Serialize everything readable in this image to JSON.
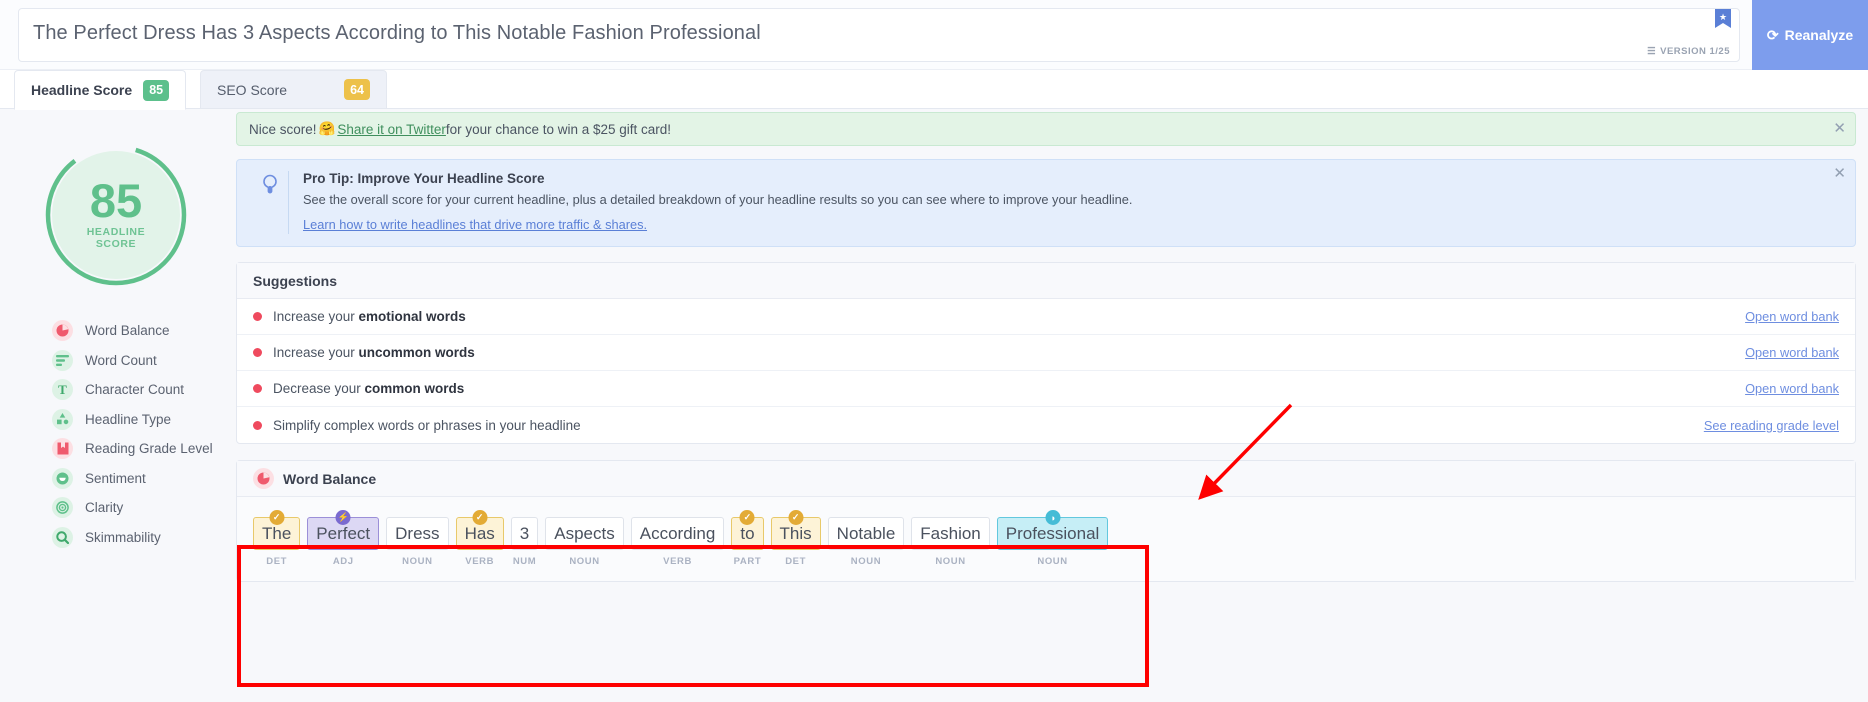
{
  "header": {
    "headline": "The Perfect Dress Has 3 Aspects According to This Notable Fashion Professional",
    "bookmark_icon": "bookmark-star-icon",
    "version_label": "VERSION 1/25",
    "version_icon": "layers-icon",
    "reanalyze_label": "Reanalyze",
    "reanalyze_icon": "refresh-icon",
    "reanalyze_color": "#7d9ded"
  },
  "tabs": [
    {
      "label": "Headline Score",
      "score": "85",
      "score_color": "#5cc08c",
      "active": true
    },
    {
      "label": "SEO Score",
      "score": "64",
      "score_color": "#edc14a",
      "active": false
    }
  ],
  "sidebar": {
    "gauge": {
      "value": "85",
      "label_line1": "HEADLINE",
      "label_line2": "SCORE",
      "color": "#5fc08b",
      "track_color": "#e2f3e9",
      "percent": 85
    },
    "items": [
      {
        "label": "Word Balance",
        "icon": "pie-chart-icon",
        "tone": "r"
      },
      {
        "label": "Word Count",
        "icon": "bars-icon",
        "tone": "g"
      },
      {
        "label": "Character Count",
        "icon": "letter-t-icon",
        "tone": "g"
      },
      {
        "label": "Headline Type",
        "icon": "shapes-icon",
        "tone": "g"
      },
      {
        "label": "Reading Grade Level",
        "icon": "bookmark-icon",
        "tone": "r"
      },
      {
        "label": "Sentiment",
        "icon": "smiley-icon",
        "tone": "g"
      },
      {
        "label": "Clarity",
        "icon": "target-icon",
        "tone": "g"
      },
      {
        "label": "Skimmability",
        "icon": "magnifier-icon",
        "tone": "g"
      }
    ]
  },
  "banners": {
    "success": {
      "prefix": "Nice score! ",
      "emoji": "🤗",
      "link": "Share it on Twitter",
      "suffix": " for your chance to win a $25 gift card!",
      "close_icon": "close-icon"
    },
    "protip": {
      "icon": "lightbulb-icon",
      "title": "Pro Tip: Improve Your Headline Score",
      "body": "See the overall score for your current headline, plus a detailed breakdown of your headline results so you can see where to improve your headline.",
      "link": "Learn how to write headlines that drive more traffic & shares.",
      "close_icon": "close-icon"
    }
  },
  "suggestions": {
    "title": "Suggestions",
    "rows": [
      {
        "prefix": "Increase your ",
        "bold": "emotional words",
        "suffix": "",
        "link": "Open word bank"
      },
      {
        "prefix": "Increase your ",
        "bold": "uncommon words",
        "suffix": "",
        "link": "Open word bank"
      },
      {
        "prefix": "Decrease your ",
        "bold": "common words",
        "suffix": "",
        "link": "Open word bank"
      },
      {
        "prefix": "Simplify complex words or phrases in your headline",
        "bold": "",
        "suffix": "",
        "link": "See reading grade level"
      }
    ]
  },
  "word_balance": {
    "title": "Word Balance",
    "icon": "pie-chart-icon",
    "words": [
      {
        "text": "The",
        "pos": "DET",
        "tone": "y",
        "badge": "✓"
      },
      {
        "text": "Perfect",
        "pos": "ADJ",
        "tone": "p",
        "badge": "⚡"
      },
      {
        "text": "Dress",
        "pos": "NOUN",
        "tone": "plain",
        "badge": ""
      },
      {
        "text": "Has",
        "pos": "VERB",
        "tone": "y",
        "badge": "✓"
      },
      {
        "text": "3",
        "pos": "NUM",
        "tone": "plain",
        "badge": ""
      },
      {
        "text": "Aspects",
        "pos": "NOUN",
        "tone": "plain",
        "badge": ""
      },
      {
        "text": "According",
        "pos": "VERB",
        "tone": "plain",
        "badge": ""
      },
      {
        "text": "to",
        "pos": "PART",
        "tone": "y",
        "badge": "✓"
      },
      {
        "text": "This",
        "pos": "DET",
        "tone": "y",
        "badge": "✓"
      },
      {
        "text": "Notable",
        "pos": "NOUN",
        "tone": "plain",
        "badge": ""
      },
      {
        "text": "Fashion",
        "pos": "NOUN",
        "tone": "plain",
        "badge": ""
      },
      {
        "text": "Professional",
        "pos": "NOUN",
        "tone": "c",
        "badge": "◑"
      }
    ]
  },
  "annotations": {
    "box_color": "#fe0000",
    "arrow_color": "#fe0000",
    "arrow_from": "1290,405",
    "arrow_to": "1197,500"
  }
}
